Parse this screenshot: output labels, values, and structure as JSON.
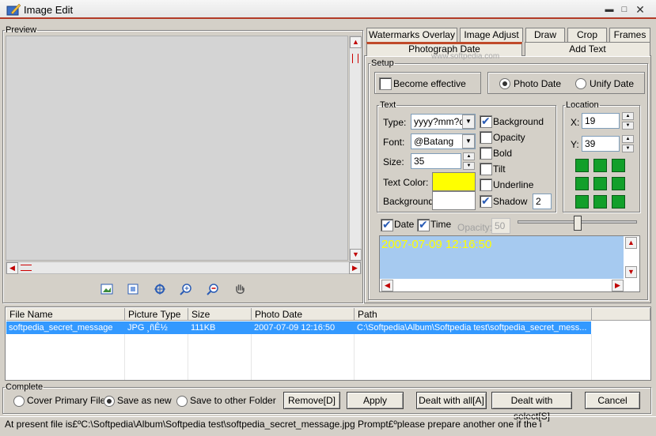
{
  "window": {
    "title": "Image Edit"
  },
  "preview": {
    "legend": "Preview"
  },
  "tabs": {
    "row1": [
      "Watermarks Overlay",
      "Image Adjust",
      "Draw",
      "Crop",
      "Frames"
    ],
    "row2": [
      "Photograph Date",
      "Add Text"
    ],
    "watermark_text": "www.softpedia.com"
  },
  "setup": {
    "legend": "Setup",
    "become_effective": "Become effective",
    "photo_date": "Photo Date",
    "unify_date": "Unify Date"
  },
  "text_group": {
    "legend": "Text",
    "type_label": "Type:",
    "type_value": "yyyy?mm?dd",
    "font_label": "Font:",
    "font_value": "@Batang",
    "size_label": "Size:",
    "size_value": "35",
    "text_color_label": "Text Color:",
    "background_label": "Background:",
    "text_color": "#ffff00",
    "background_color": "#ffffff",
    "background_check": "Background",
    "opacity_check": "Opacity",
    "bold_check": "Bold",
    "tilt_check": "Tilt",
    "underline_check": "Underline",
    "shadow_check": "Shadow",
    "shadow_value": "2"
  },
  "location": {
    "legend": "Location",
    "x_label": "X:",
    "x_value": "19",
    "y_label": "Y:",
    "y_value": "39"
  },
  "options": {
    "date_check": "Date",
    "time_check": "Time",
    "opacity_label": "Opacity:",
    "opacity_value": "50",
    "preview_text": "2007-07-09 12:16:50"
  },
  "table": {
    "headers": [
      "File Name",
      "Picture Type",
      "Size",
      "Photo Date",
      "Path"
    ],
    "rows": [
      [
        "softpedia_secret_message",
        "JPG ¸ñÊ½",
        "111KB",
        "2007-07-09 12:16:50",
        "C:\\Softpedia\\Album\\Softpedia test\\softpedia_secret_mess..."
      ]
    ]
  },
  "complete": {
    "legend": "Complete",
    "cover_primary": "Cover Primary File",
    "save_as_new": "Save as new",
    "save_to_other": "Save to other Folder",
    "remove": "Remove[D]",
    "apply": "Apply",
    "dealt_all": "Dealt with all[A]",
    "dealt_select": "Dealt with select[S]",
    "cancel": "Cancel"
  },
  "status": {
    "text": "At present file is£ºC:\\Softpedia\\Album\\Softpedia test\\softpedia_secret_message.jpg  Prompt£ºplease prepare another one if the i"
  }
}
